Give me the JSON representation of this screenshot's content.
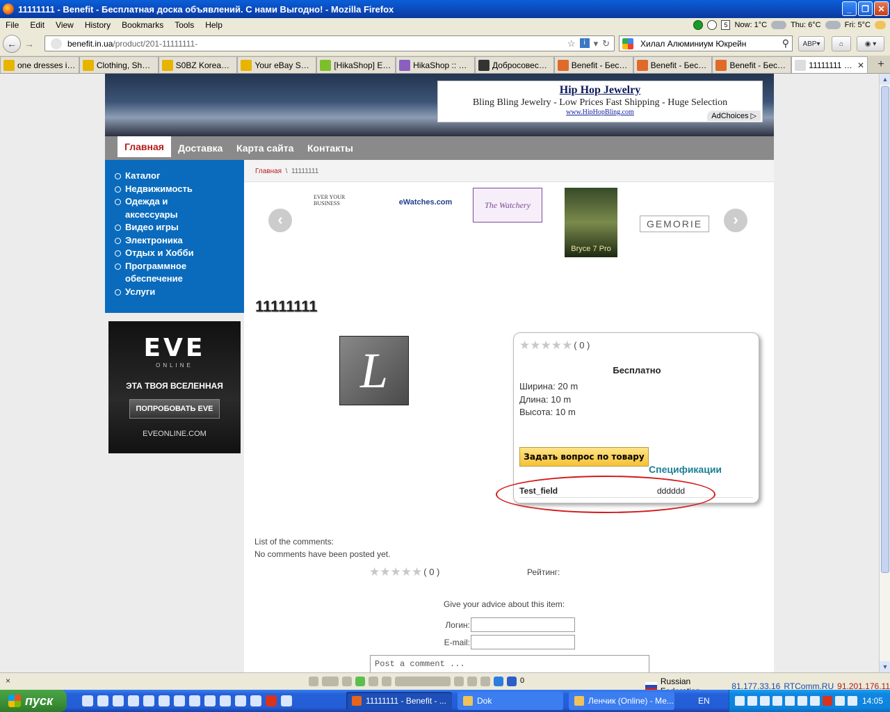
{
  "window": {
    "title": "11111111 - Benefit - Бесплатная доска объявлений. С нами Выгодно! - Mozilla Firefox"
  },
  "menubar": {
    "items": [
      "File",
      "Edit",
      "View",
      "History",
      "Bookmarks",
      "Tools",
      "Help"
    ],
    "weather_now": "Now: 1°C",
    "weather_thu": "Thu: 6°C",
    "weather_fri": "Fri: 5°C",
    "calendar_day": "5"
  },
  "navbar": {
    "url_host": "benefit.in.ua",
    "url_path": "/product/201-11111111-",
    "search_value": "Хилал Алюминиум Юкрейн",
    "abp_label": "ABP"
  },
  "tabs": [
    {
      "label": "one dresses in ...",
      "icon_color": "#e7b400"
    },
    {
      "label": "Clothing, Shoes...",
      "icon_color": "#e7b400"
    },
    {
      "label": "S0BZ Korean W...",
      "icon_color": "#e7b400"
    },
    {
      "label": "Your eBay Shop...",
      "icon_color": "#e7b400"
    },
    {
      "label": "[HikaShop] Еще...",
      "icon_color": "#7dbf2a"
    },
    {
      "label": "HikaShop :: Rep...",
      "icon_color": "#8b5fbf"
    },
    {
      "label": "Добросовестн...",
      "icon_color": "#333333"
    },
    {
      "label": "Benefit - Беспл...",
      "icon_color": "#e06a2a"
    },
    {
      "label": "Benefit - Беспл...",
      "icon_color": "#e06a2a"
    },
    {
      "label": "Benefit - Беспл...",
      "icon_color": "#e06a2a"
    },
    {
      "label": "11111111 - ...",
      "icon_color": "#dddddd"
    }
  ],
  "ad": {
    "title": "Hip Hop Jewelry",
    "description": "Bling Bling Jewelry - Low Prices Fast Shipping - Huge Selection",
    "link": "www.HipHopBling.com",
    "choices": "AdChoices"
  },
  "topnav": {
    "items": [
      "Главная",
      "Доставка",
      "Карта сайта",
      "Контакты"
    ]
  },
  "sidebar": {
    "items": [
      "Каталог",
      "Недвижимость",
      "Одежда и аксессуары",
      "Видео игры",
      "Электроника",
      "Отдых и Хобби",
      "Программное обеспечение",
      "Услуги"
    ]
  },
  "eve_ad": {
    "logo": "EVE",
    "sub": "ONLINE",
    "tagline": "ЭТА ТВОЯ ВСЕЛЕННАЯ",
    "button": "ПОПРОБОВАТЬ EVE",
    "url": "EVEONLINE.COM"
  },
  "breadcrumb": {
    "home": "Главная",
    "sep": "\\",
    "current": "11111111"
  },
  "carousel": {
    "logos": [
      "EVER YOUR BUSINESS",
      "eWatches.com",
      "The Watchery",
      "Bryce 7 Pro",
      "GEMORIE"
    ]
  },
  "product": {
    "title": "11111111",
    "image_letter": "L",
    "rating_count": "( 0 )",
    "price": "Бесплатно",
    "width": "Ширина: 20 m",
    "length": "Длина: 10 m",
    "height": "Высота: 10 m",
    "ask_button": "Задать вопрос по товару",
    "spec_title": "Спецификации",
    "spec_name": "Test_field",
    "spec_value": "dddddd"
  },
  "comments": {
    "list_label": "List of the comments:",
    "empty": "No comments have been posted yet.",
    "rating_count": "( 0 )",
    "rating_label": "Рейтинг:",
    "advice": "Give your advice about this item:",
    "login_label": "Логин:",
    "email_label": "E-mail:",
    "comment_placeholder": "Post a comment ..."
  },
  "statusbar": {
    "close": "×",
    "counter": "0",
    "country": "Russian Federation",
    "ip": "81.177.33.16",
    "isp": "RTComm.RU",
    "ip2": "91.201.176.11"
  },
  "taskbar": {
    "start": "пуск",
    "tasks": [
      "11111111 - Benefit - ...",
      "Dok",
      "Ленчик (Online) - Ме..."
    ],
    "lang": "EN",
    "time": "14:05"
  }
}
